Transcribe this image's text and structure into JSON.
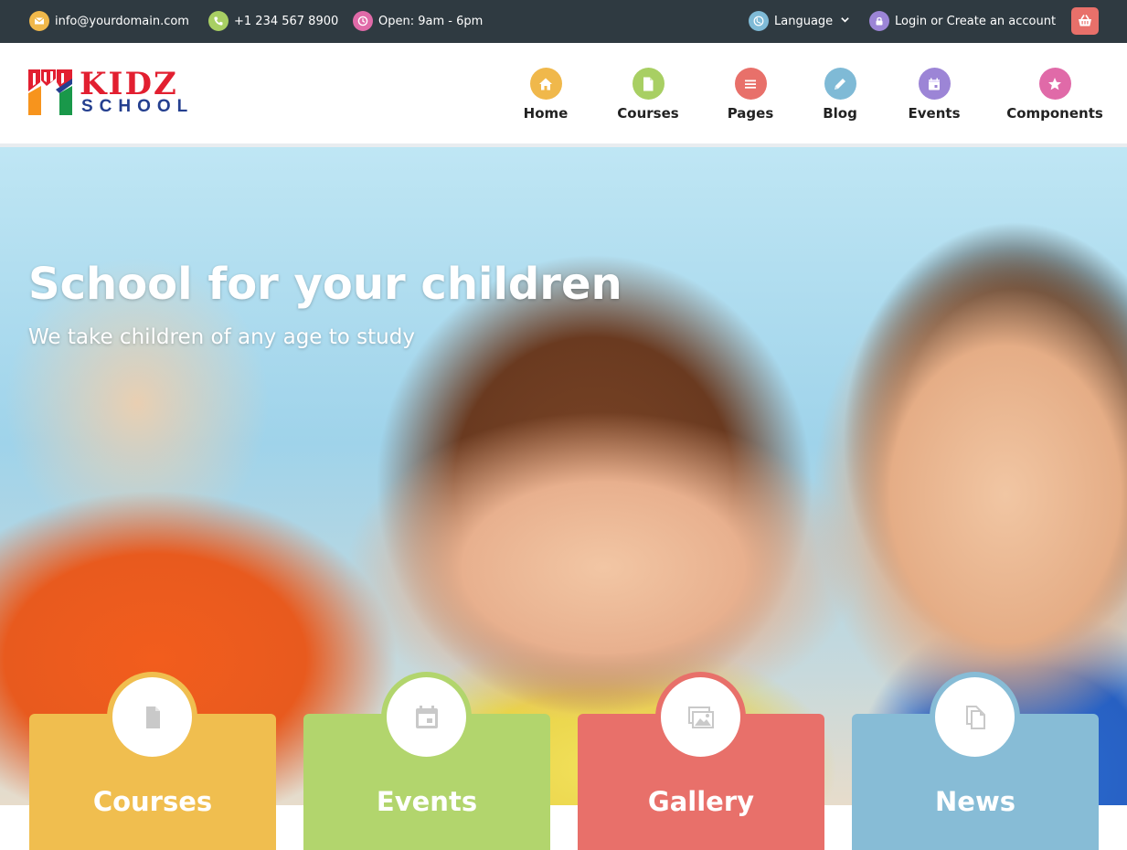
{
  "topbar": {
    "email": {
      "icon": "envelope-icon",
      "text": "info@yourdomain.com",
      "color": "#f0b84b"
    },
    "phone": {
      "icon": "phone-icon",
      "text": "+1 234 567 8900",
      "color": "#a8cf63"
    },
    "hours": {
      "icon": "clock-icon",
      "text": "Open: 9am - 6pm",
      "color": "#e06aa8"
    },
    "language": {
      "icon": "globe-icon",
      "text": "Language",
      "color": "#7fbad6"
    },
    "account": {
      "icon": "lock-icon",
      "text": "Login or Create an account",
      "color": "#9c85d6"
    },
    "cart": {
      "icon": "basket-icon",
      "color": "#e8706a"
    }
  },
  "logo": {
    "line1": "KIDZ",
    "line2": "SCHOOL"
  },
  "nav": [
    {
      "label": "Home",
      "icon": "home-icon",
      "color": "#f0b84b"
    },
    {
      "label": "Courses",
      "icon": "document-icon",
      "color": "#a8cf63"
    },
    {
      "label": "Pages",
      "icon": "menu-icon",
      "color": "#e8706a"
    },
    {
      "label": "Blog",
      "icon": "pencil-icon",
      "color": "#7fbad6"
    },
    {
      "label": "Events",
      "icon": "calendar-icon",
      "color": "#9c85d6"
    },
    {
      "label": "Components",
      "icon": "star-icon",
      "color": "#e06aa8"
    }
  ],
  "hero": {
    "title": "School for your children",
    "subtitle": "We take children of any age to study"
  },
  "features": [
    {
      "label": "Courses",
      "icon": "document-icon",
      "color": "#f0be4f"
    },
    {
      "label": "Events",
      "icon": "calendar-icon",
      "color": "#b2d56d"
    },
    {
      "label": "Gallery",
      "icon": "pictures-icon",
      "color": "#e8706a"
    },
    {
      "label": "News",
      "icon": "copy-icon",
      "color": "#87bcd6"
    }
  ]
}
